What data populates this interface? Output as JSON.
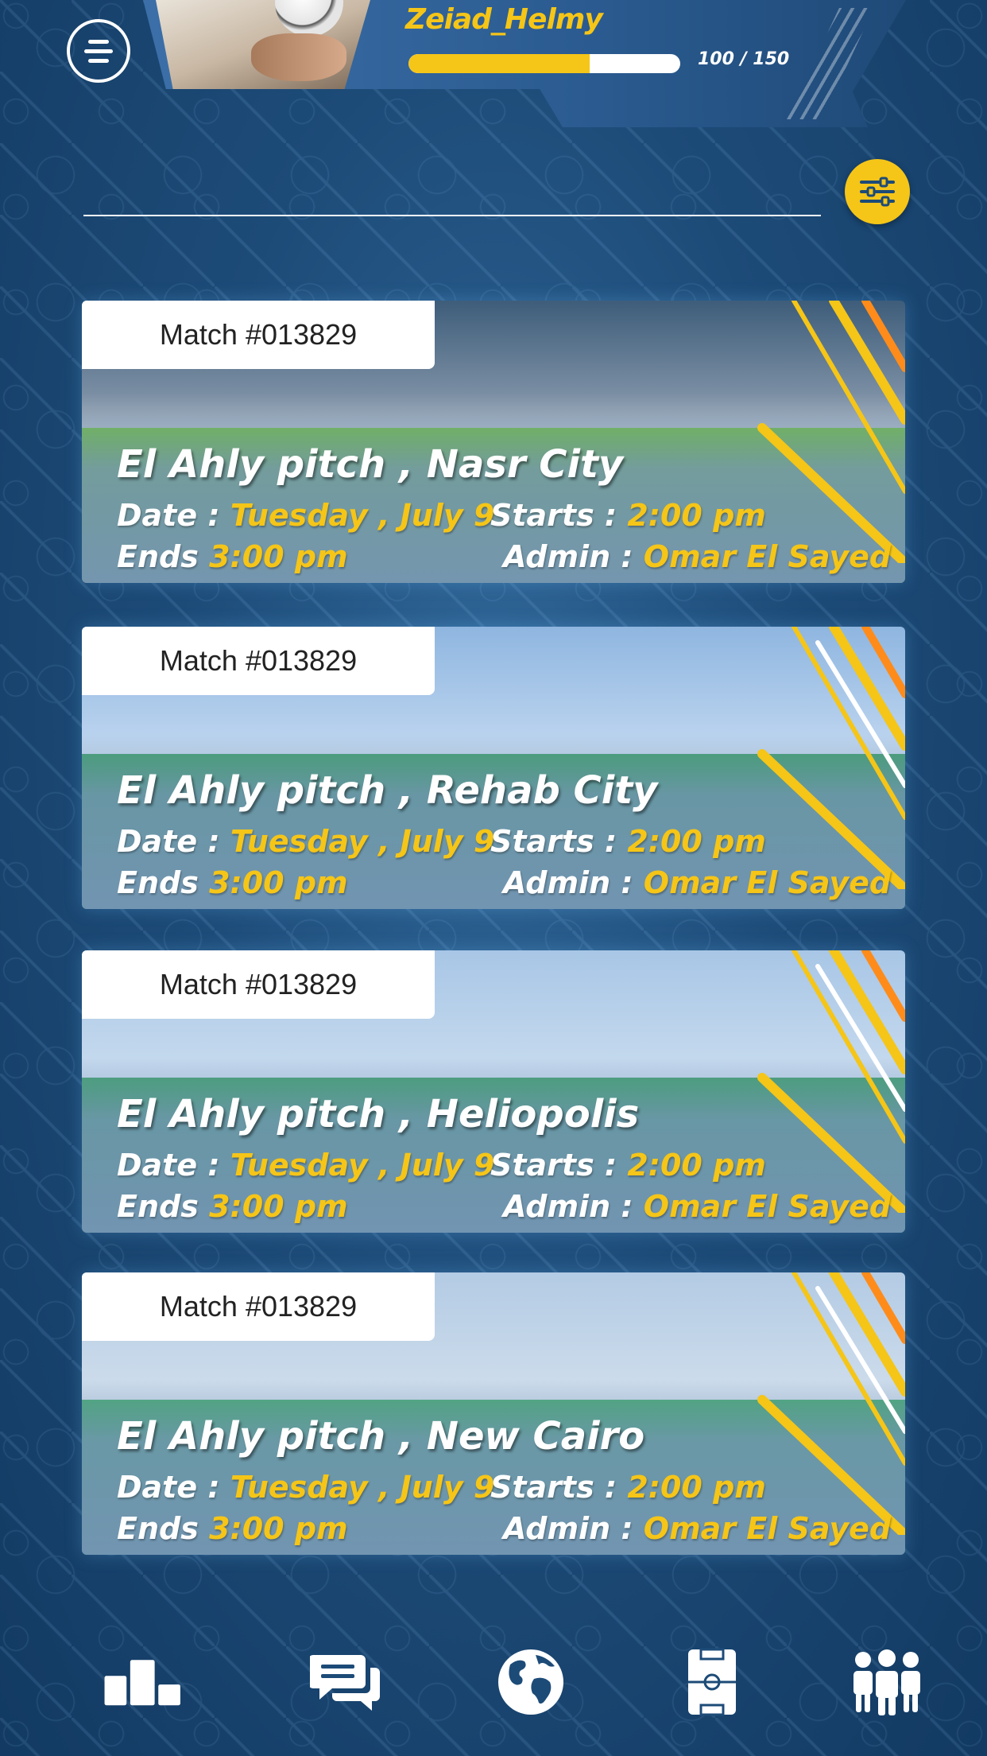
{
  "header": {
    "username": "Zeiad_Helmy",
    "xp_text": "100 / 150",
    "xp_progress": 0.6667
  },
  "matches": [
    {
      "badge": "Match #013829",
      "pitch": "El Ahly pitch , Nasr City",
      "date_label": "Date :",
      "date_value": "Tuesday , July 9",
      "starts_label": "Starts :",
      "starts_value": "2:00 pm",
      "ends_label": "Ends",
      "ends_value": "3:00 pm",
      "admin_label": "Admin :",
      "admin_value": "Omar El Sayed"
    },
    {
      "badge": "Match #013829",
      "pitch": "El Ahly pitch , Rehab City",
      "date_label": "Date :",
      "date_value": "Tuesday , July 9",
      "starts_label": "Starts :",
      "starts_value": "2:00 pm",
      "ends_label": "Ends",
      "ends_value": "3:00 pm",
      "admin_label": "Admin :",
      "admin_value": "Omar El Sayed"
    },
    {
      "badge": "Match #013829",
      "pitch": "El Ahly pitch , Heliopolis",
      "date_label": "Date :",
      "date_value": "Tuesday , July 9",
      "starts_label": "Starts :",
      "starts_value": "2:00 pm",
      "ends_label": "Ends",
      "ends_value": "3:00 pm",
      "admin_label": "Admin :",
      "admin_value": "Omar El Sayed"
    },
    {
      "badge": "Match #013829",
      "pitch": "El Ahly pitch , New Cairo",
      "date_label": "Date :",
      "date_value": "Tuesday , July 9",
      "starts_label": "Starts :",
      "starts_value": "2:00 pm",
      "ends_label": "Ends",
      "ends_value": "3:00 pm",
      "admin_label": "Admin :",
      "admin_value": "Omar El Sayed"
    }
  ],
  "nav": {
    "items": [
      "leaderboard-icon",
      "chat-icon",
      "globe-icon",
      "pitch-icon",
      "team-icon"
    ]
  },
  "colors": {
    "accent": "#f5c518",
    "background": "#1d4b78",
    "card_overlay": "#7896b9"
  }
}
